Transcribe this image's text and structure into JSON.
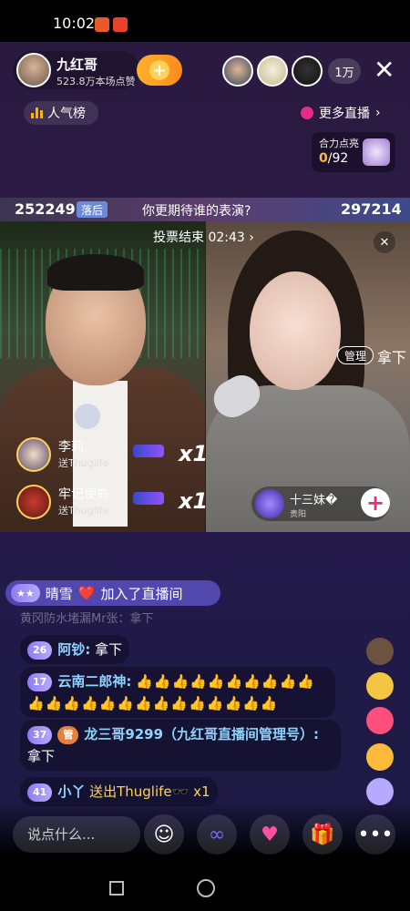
{
  "status": {
    "time": "10:02"
  },
  "header": {
    "host_name": "九红哥",
    "host_likes": "523.8万本场点赞",
    "follow_symbol": "+",
    "viewer_count": "1万",
    "close_symbol": "✕",
    "rank_label": "人气榜",
    "more_live_label": "更多直播",
    "more_live_arrow": "›"
  },
  "power": {
    "label": "合力点亮",
    "current": "0",
    "total": "/92"
  },
  "pk": {
    "left_score": "252249",
    "left_tag": "落后",
    "question": "你更期待谁的表演?",
    "right_score": "297214",
    "timer_text": "投票结束 02:43",
    "timer_arrow": "›"
  },
  "left_video": {
    "gifts": [
      {
        "name": "李莉.",
        "sub": "送Thuglife",
        "mult": "x1"
      },
      {
        "name": "牢记使命",
        "sub": "送Thuglife",
        "mult": "x1"
      }
    ]
  },
  "right_video": {
    "mute_symbol": "✕",
    "admin_tag": "管理",
    "admin_text": "拿下",
    "guest_name": "十三妹�",
    "guest_sub": "贵阳",
    "guest_add": "+"
  },
  "chat": {
    "join": {
      "level": "★★",
      "name": "晴雪",
      "heart": "❤️",
      "action": "加入了直播间"
    },
    "faded": "黄冈防水堵漏Mr张：拿下",
    "messages": [
      {
        "level": "26",
        "user": "阿钞:",
        "text": "拿下"
      },
      {
        "level": "17",
        "user": "云南二郎神:",
        "text": "👍👍👍👍👍👍👍👍👍👍👍👍👍👍👍👍👍👍👍👍👍👍👍👍"
      },
      {
        "level": "37",
        "badge": "管",
        "user": "龙三哥9299（九红哥直播间管理号）:",
        "text": "拿下"
      },
      {
        "level": "41",
        "user": "小丫",
        "text": "送出Thuglife🕶️ x1"
      }
    ]
  },
  "input": {
    "placeholder": "说点什么..."
  },
  "toolbar": {
    "emoji": "☺",
    "link": "∞",
    "heart": "♥",
    "gift": "🎁",
    "more": "•••"
  },
  "colors": {
    "accent": "#e52d86",
    "follow": "#ffb12b",
    "username": "#8fd4ff"
  }
}
